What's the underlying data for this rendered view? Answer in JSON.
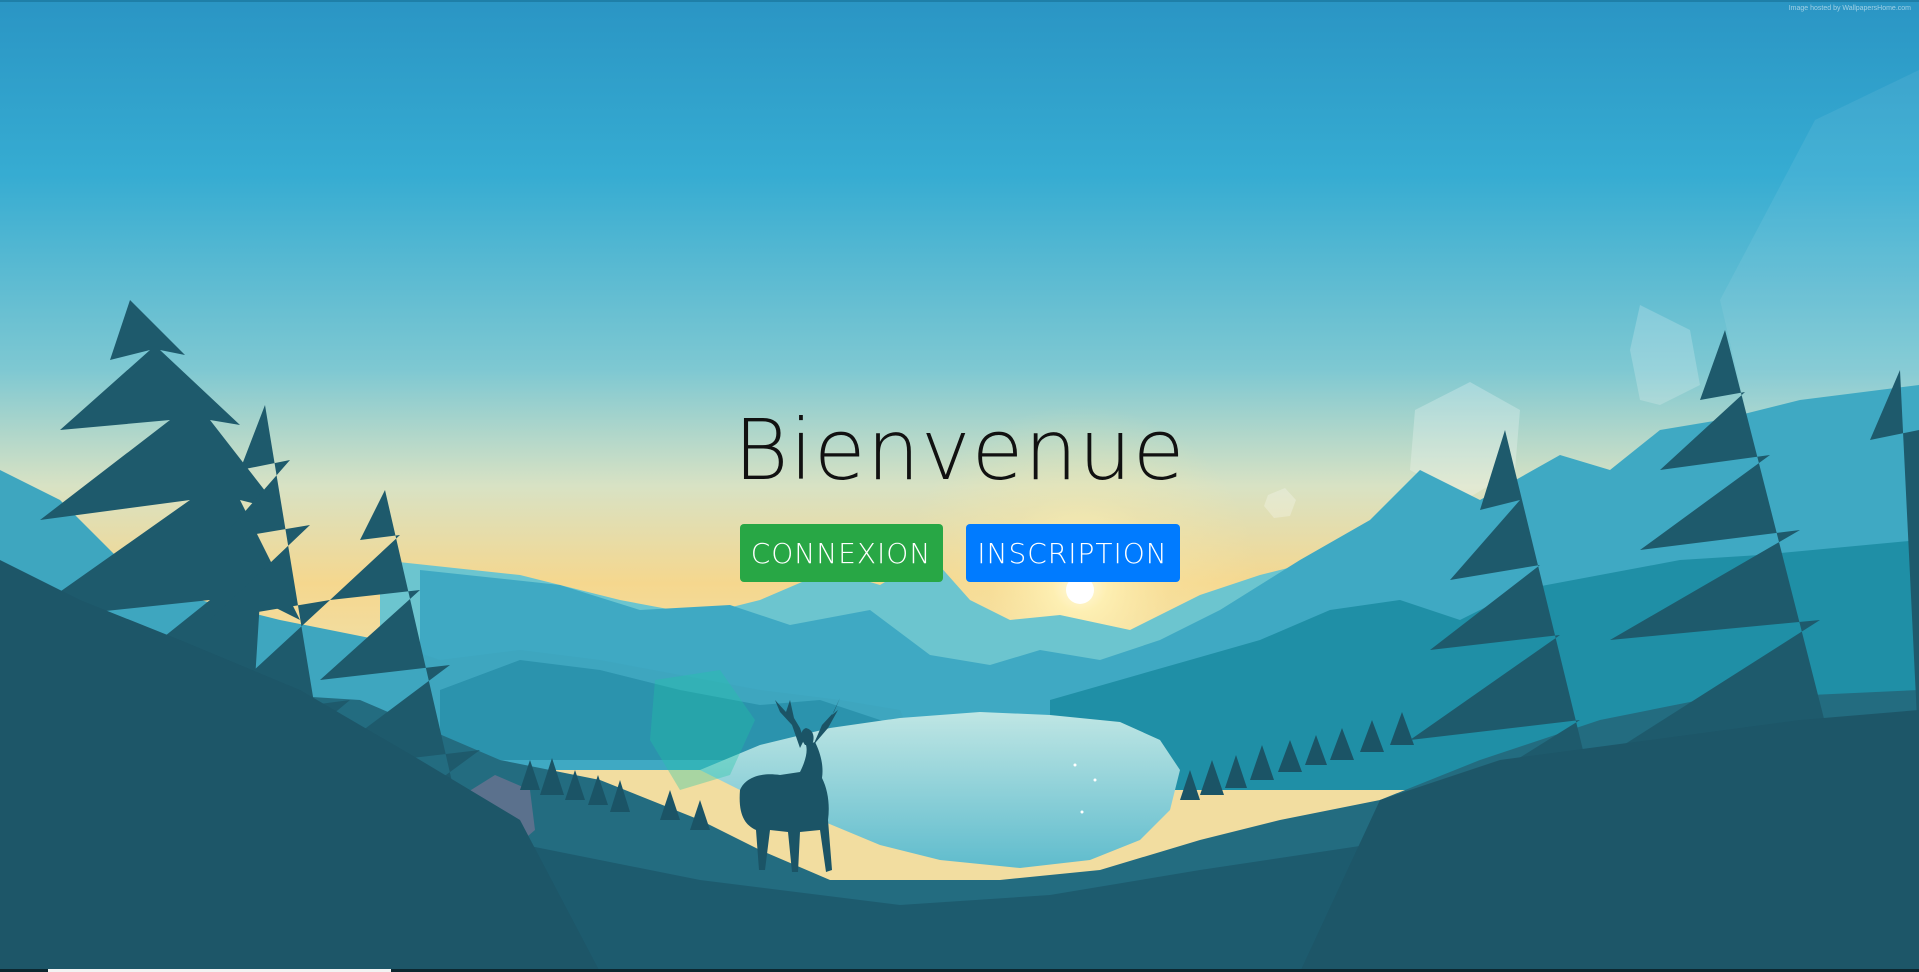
{
  "hero": {
    "title": "Bienvenue",
    "login_label": "CONNEXION",
    "register_label": "INSCRIPTION"
  },
  "background": {
    "credit_text": "Image hosted by WallpapersHome.com"
  },
  "colors": {
    "login_button": "#28a745",
    "register_button": "#007bff",
    "sky_top": "#2a9cc8",
    "sky_horizon": "#f5d78e",
    "forest_dark": "#1d5a6e"
  }
}
